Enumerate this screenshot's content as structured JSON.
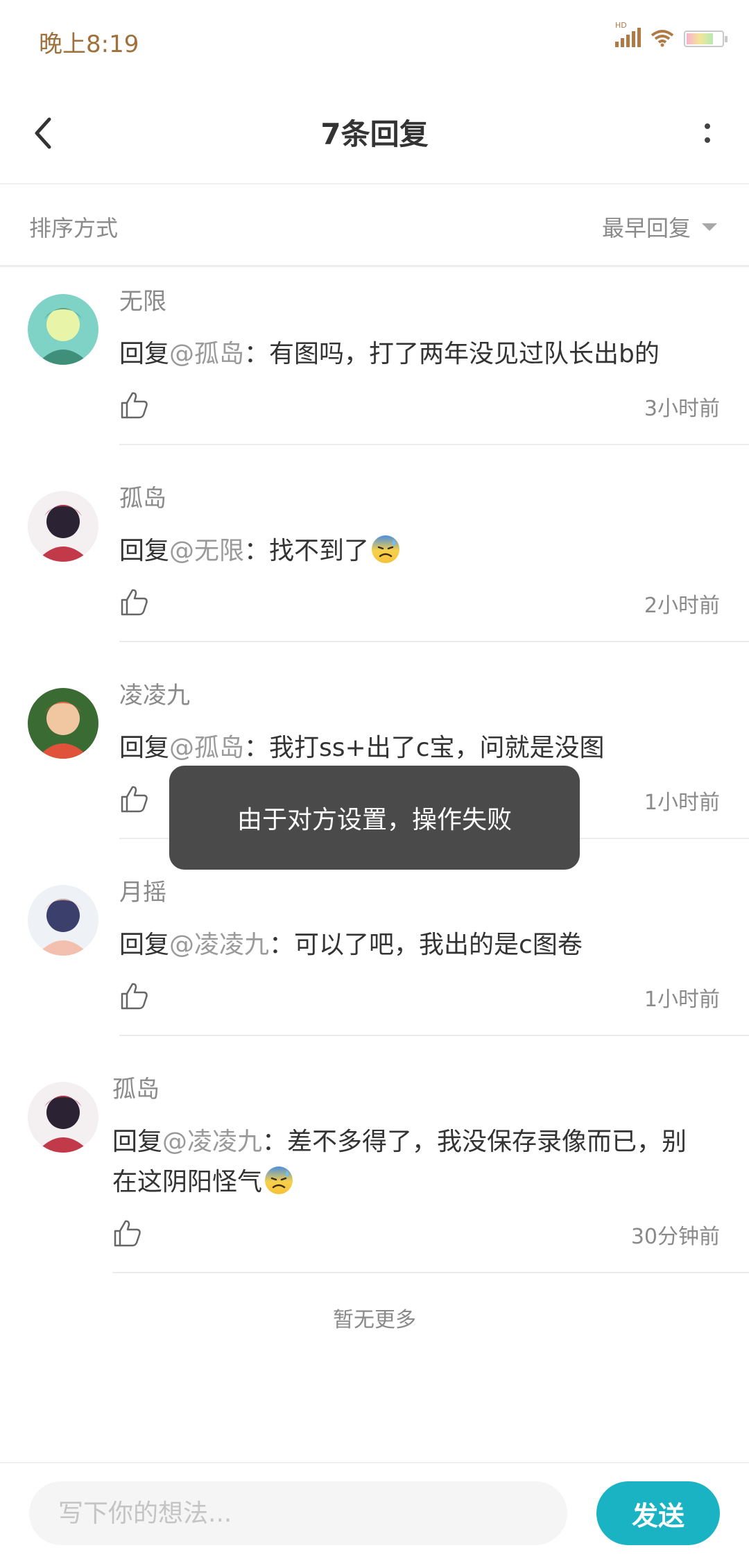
{
  "status_bar": {
    "time": "晚上8:19",
    "network_label": "HD"
  },
  "header": {
    "title": "7条回复"
  },
  "sort": {
    "label": "排序方式",
    "value": "最早回复"
  },
  "comments": [
    {
      "author": "无限",
      "reply_prefix": "回复",
      "reply_to": "@孤岛",
      "separator": "：",
      "text": "有图吗，打了两年没见过队长出b的",
      "time": "3小时前",
      "avatar_colors": [
        "#7fd3c6",
        "#e8f4a8",
        "#3f8f7a"
      ]
    },
    {
      "author": "孤岛",
      "reply_prefix": "回复",
      "reply_to": "@无限",
      "separator": "：",
      "text": "找不到了",
      "time": "2小时前",
      "has_emoji": true,
      "avatar_colors": [
        "#f4f0f2",
        "#2b2233",
        "#c23a4a"
      ]
    },
    {
      "author": "凌凌九",
      "reply_prefix": "回复",
      "reply_to": "@孤岛",
      "separator": "：",
      "text": "我打ss+出了c宝，问就是没图",
      "time": "1小时前",
      "avatar_colors": [
        "#3a6b32",
        "#f0c7a0",
        "#e0533a"
      ]
    },
    {
      "author": "月摇",
      "reply_prefix": "回复",
      "reply_to": "@凌凌九",
      "separator": "：",
      "text": "可以了吧，我出的是c图卷",
      "time": "1小时前",
      "avatar_colors": [
        "#eef2f6",
        "#3a3f6b",
        "#f3c0b0"
      ]
    },
    {
      "author": "孤岛",
      "reply_prefix": "回复",
      "reply_to": "@凌凌九",
      "separator": "：",
      "text": "差不多得了，我没保存录像而已，别在这阴阳怪气",
      "time": "30分钟前",
      "has_emoji": true,
      "avatar_colors": [
        "#f4f0f2",
        "#2b2233",
        "#c23a4a"
      ]
    }
  ],
  "footer_note": "暂无更多",
  "toast": {
    "message": "由于对方设置，操作失败"
  },
  "input": {
    "placeholder": "写下你的想法...",
    "value": ""
  },
  "send_button": {
    "label": "发送"
  },
  "colors": {
    "accent": "#1ab3c4",
    "toast_bg": "#4a4a4a",
    "time_color": "#a0703a"
  },
  "icons": [
    "back-arrow-icon",
    "more-vertical-icon",
    "caret-down-icon",
    "thumbs-up-icon",
    "sweat-emoji-icon",
    "signal-icon",
    "wifi-icon",
    "battery-icon"
  ]
}
